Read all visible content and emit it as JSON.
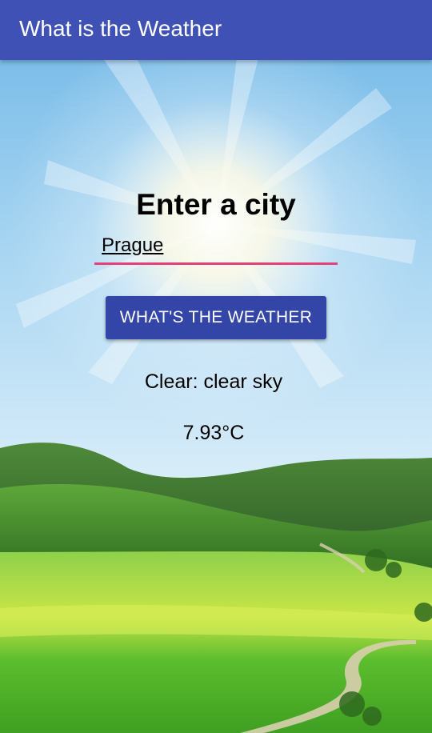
{
  "app_bar": {
    "title": "What is the Weather"
  },
  "form": {
    "prompt": "Enter a city",
    "city_value": "Prague",
    "button_label": "WHAT'S THE WEATHER"
  },
  "result": {
    "description": "Clear: clear sky",
    "temperature": "7.93°C"
  },
  "colors": {
    "app_bar": "#3f51b5",
    "button": "#3445a8",
    "input_underline": "#e5407a"
  }
}
